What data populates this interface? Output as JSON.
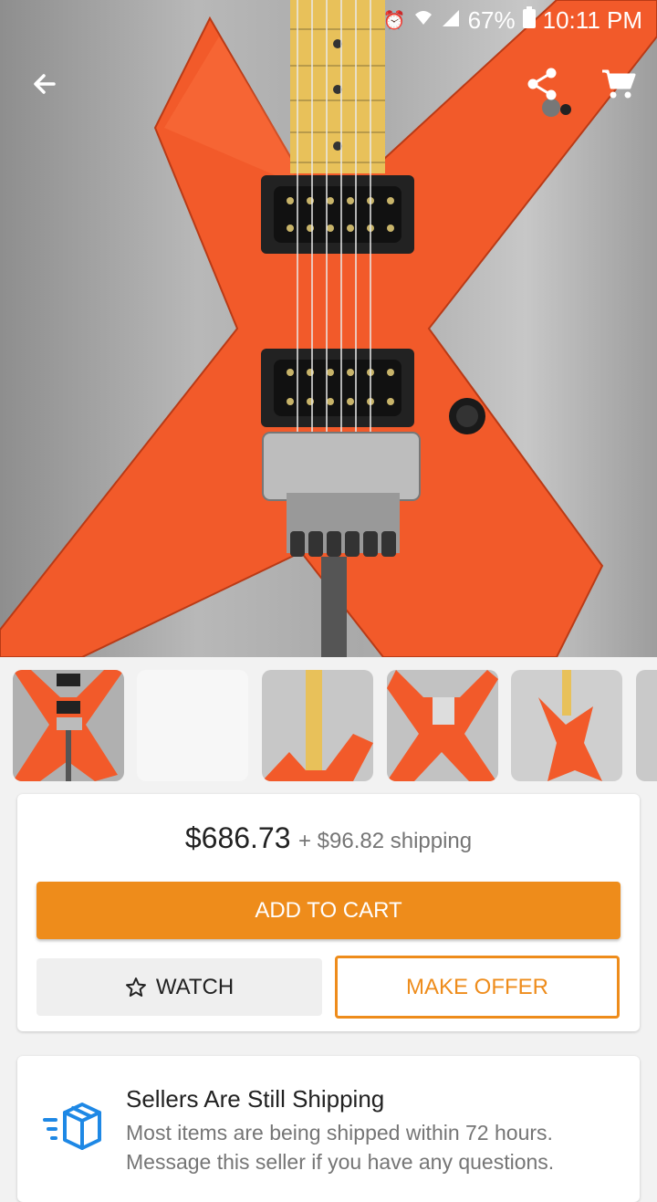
{
  "status_bar": {
    "battery": "67%",
    "time": "10:11 PM",
    "icons": [
      "alarm-icon",
      "wifi-icon",
      "signal-icon",
      "battery-icon"
    ]
  },
  "nav": {
    "icons": [
      "back-arrow-icon",
      "share-icon",
      "cart-icon"
    ]
  },
  "listing": {
    "price": "$686.73",
    "shipping": "+ $96.82 shipping",
    "add_to_cart_label": "ADD TO CART",
    "watch_label": "WATCH",
    "make_offer_label": "MAKE OFFER"
  },
  "notice": {
    "title": "Sellers Are Still Shipping",
    "body": "Most items are being shipped within 72 hours. Message this seller if you have any questions."
  },
  "colors": {
    "accent": "#ee8c1b",
    "guitar_body": "#f25a2a",
    "fretboard": "#e8c15a"
  }
}
